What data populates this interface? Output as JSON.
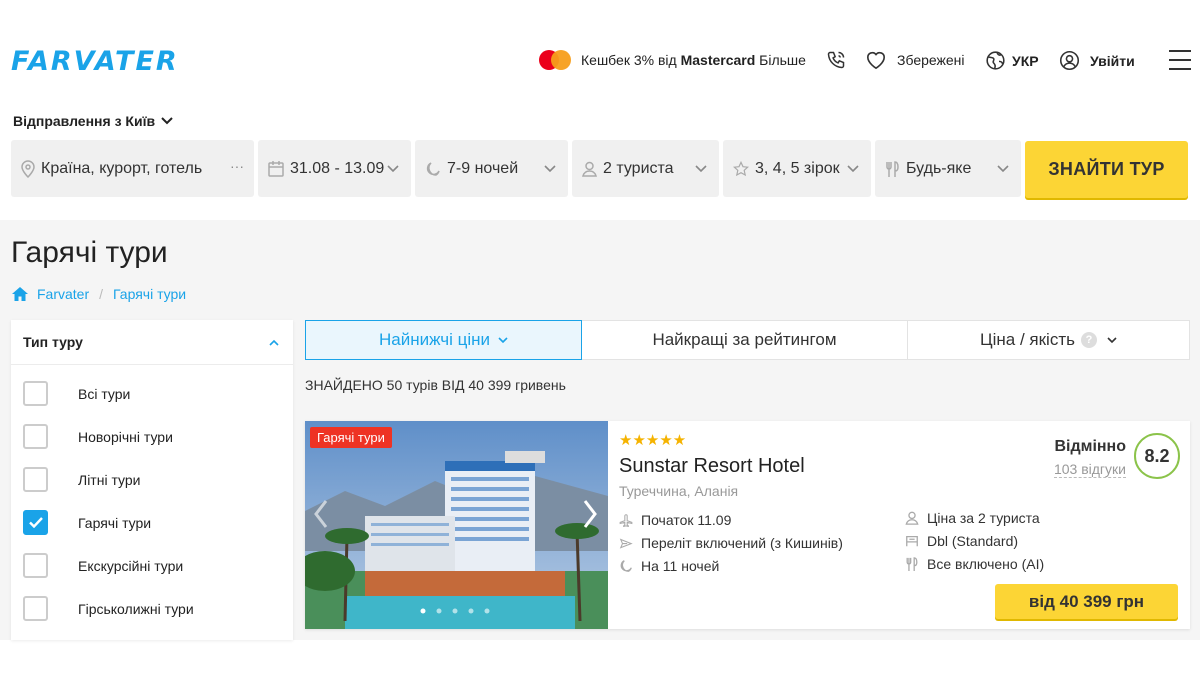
{
  "header": {
    "logo": "FARVATER",
    "cashback": "Кешбек 3% від",
    "cashback_brand": "Mastercard",
    "cashback_more": "Більше",
    "saved": "Збережені",
    "lang": "УКР",
    "login": "Увійти"
  },
  "departure": "Відправлення з Київ",
  "search": {
    "destination": "Країна, курорт, готель",
    "dates": "31.08 - 13.09",
    "nights": "7-9 ночей",
    "tourists": "2 туриста",
    "stars": "3, 4, 5 зірок",
    "meal": "Будь-яке",
    "button": "ЗНАЙТИ ТУР"
  },
  "page_title": "Гарячі тури",
  "breadcrumb": {
    "home": "Farvater",
    "current": "Гарячі тури"
  },
  "filter": {
    "title": "Тип туру",
    "options": [
      {
        "label": "Всі тури",
        "checked": false
      },
      {
        "label": "Новорічні тури",
        "checked": false
      },
      {
        "label": "Літні тури",
        "checked": false
      },
      {
        "label": "Гарячі тури",
        "checked": true
      },
      {
        "label": "Екскурсійні тури",
        "checked": false
      },
      {
        "label": "Гірськолижні тури",
        "checked": false
      }
    ]
  },
  "sort_tabs": [
    "Найнижчі ціни",
    "Найкращі за рейтингом",
    "Ціна / якість"
  ],
  "found_text": "ЗНАЙДЕНО 50 турів ВІД 40 399 гривень",
  "hotel": {
    "badge": "Гарячі тури",
    "stars": 5,
    "name": "Sunstar Resort Hotel",
    "location": "Туреччина, Аланія",
    "start": "Початок 11.09",
    "flight": "Переліт включений (з Кишинів)",
    "nights": "На 11 ночей",
    "price_for": "Ціна за 2 туриста",
    "room": "Dbl (Standard)",
    "meal": "Все включено (AI)",
    "rating_label": "Відмінно",
    "reviews": "103 відгуки",
    "score": "8.2",
    "price": "від 40 399 грн"
  },
  "colors": {
    "accent": "#1aa3e8",
    "button": "#fcd535",
    "hot": "#ee3324",
    "score_ring": "#8bc34a"
  }
}
